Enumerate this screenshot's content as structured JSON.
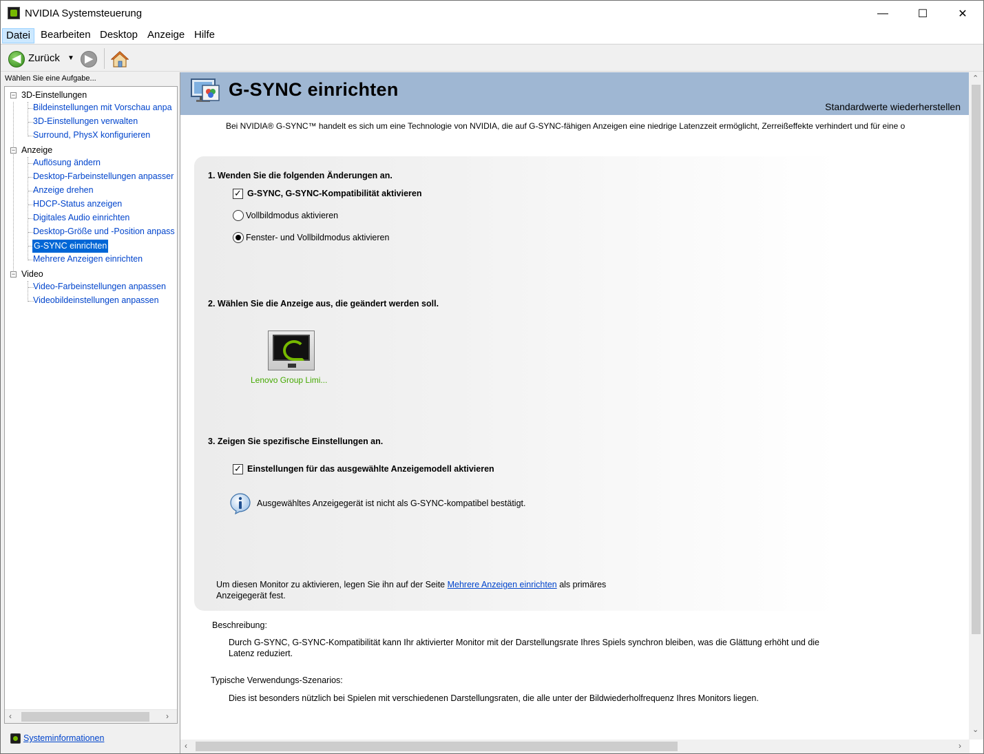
{
  "window": {
    "title": "NVIDIA Systemsteuerung",
    "minimize": "—",
    "maximize": "☐",
    "close": "✕"
  },
  "menu": {
    "file": "Datei",
    "edit": "Bearbeiten",
    "desktop": "Desktop",
    "view": "Anzeige",
    "help": "Hilfe"
  },
  "toolbar": {
    "back_label": "Zurück",
    "back_glyph": "◀",
    "dropdown_glyph": "▼",
    "forward_glyph": "▶"
  },
  "sidebar": {
    "task_label": "Wählen Sie eine Aufgabe...",
    "categories": [
      {
        "label": "3D-Einstellungen",
        "items": [
          "Bildeinstellungen mit Vorschau anpa",
          "3D-Einstellungen verwalten",
          "Surround, PhysX konfigurieren"
        ]
      },
      {
        "label": "Anzeige",
        "items": [
          "Auflösung ändern",
          "Desktop-Farbeinstellungen anpasser",
          "Anzeige drehen",
          "HDCP-Status anzeigen",
          "Digitales Audio einrichten",
          "Desktop-Größe und -Position anpass",
          "G-SYNC einrichten",
          "Mehrere Anzeigen einrichten"
        ]
      },
      {
        "label": "Video",
        "items": [
          "Video-Farbeinstellungen anpassen",
          "Videobildeinstellungen anpassen"
        ]
      }
    ],
    "selected": "G-SYNC einrichten",
    "expander_glyph": "−",
    "sysinfo_link": "Systeminformationen"
  },
  "page": {
    "title": "G-SYNC einrichten",
    "restore_link": "Standardwerte wiederherstellen",
    "intro": "Bei NVIDIA® G-SYNC™ handelt es sich um eine Technologie von NVIDIA, die auf G-SYNC-fähigen Anzeigen eine niedrige Latenzzeit ermöglicht, Zerreißeffekte verhindert und für eine o",
    "step1": {
      "heading": "1. Wenden Sie die folgenden Änderungen an.",
      "checkbox_label": "G-SYNC, G-SYNC-Kompatibilität aktivieren",
      "checkbox_checked": true,
      "radio_fullscreen": "Vollbildmodus aktivieren",
      "radio_windowed": "Fenster- und Vollbildmodus aktivieren",
      "selected_radio": "Fenster- und Vollbildmodus aktivieren"
    },
    "step2": {
      "heading": "2. Wählen Sie die Anzeige aus, die geändert werden soll.",
      "display_name": "Lenovo Group Limi..."
    },
    "step3": {
      "heading": "3. Zeigen Sie spezifische Einstellungen an.",
      "checkbox_label": "Einstellungen für das ausgewählte Anzeigemodell aktivieren",
      "checkbox_checked": true,
      "info_text": "Ausgewähltes Anzeigegerät ist nicht als G-SYNC-kompatibel bestätigt."
    },
    "note": {
      "prefix": "Um diesen Monitor zu aktivieren, legen Sie ihn auf der Seite ",
      "link": "Mehrere Anzeigen einrichten",
      "suffix": " als primäres Anzeigegerät fest."
    },
    "description": {
      "heading": "Beschreibung:",
      "body": "Durch G-SYNC, G-SYNC-Kompatibilität kann Ihr aktivierter Monitor mit der Darstellungsrate Ihres Spiels synchron bleiben, was die Glättung erhöht und die Latenz reduziert."
    },
    "usage": {
      "heading": "Typische Verwendungs-Szenarios:",
      "body": "Dies ist besonders nützlich bei Spielen mit verschiedenen Darstellungsraten, die alle unter der Bildwiederholfrequenz Ihres Monitors liegen."
    }
  },
  "colors": {
    "banner": "#9fb7d3",
    "link": "#0044cc",
    "selection": "#0066d6",
    "nvidia_green": "#76b900"
  },
  "icons": {
    "check": "✓",
    "up_arrow": "⌃",
    "down_arrow": "⌄",
    "left_arrow": "‹",
    "right_arrow": "›"
  }
}
